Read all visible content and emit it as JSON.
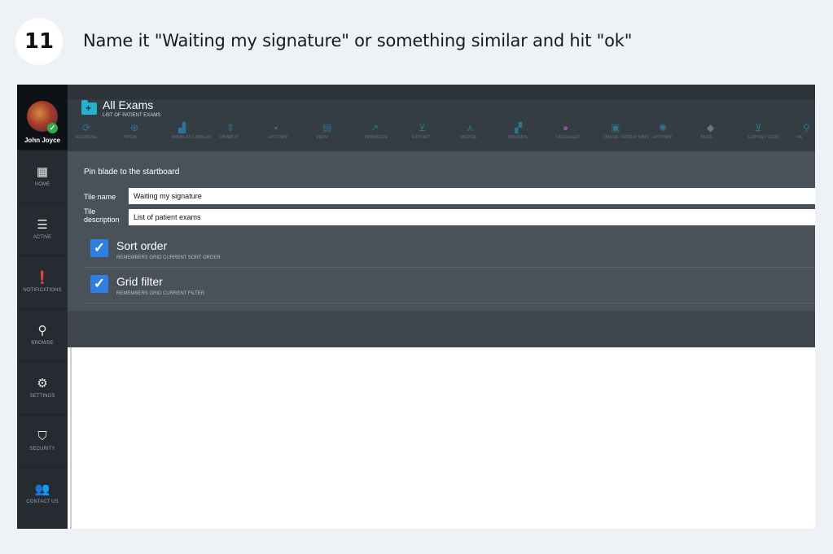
{
  "step": {
    "number": "11",
    "instruction": "Name it \"Waiting my signature\" or something similar and hit \"ok\""
  },
  "user": {
    "name": "John Joyce"
  },
  "sidebar": {
    "items": [
      {
        "label": "HOME",
        "icon": "home-grid-icon"
      },
      {
        "label": "ACTIVE",
        "icon": "list-icon"
      },
      {
        "label": "NOTIFICATIONS",
        "icon": "alert-icon"
      },
      {
        "label": "BROWSE",
        "icon": "search-icon"
      },
      {
        "label": "SETTINGS",
        "icon": "gear-icon"
      },
      {
        "label": "SECURITY",
        "icon": "shield-icon"
      },
      {
        "label": "CONTACT US",
        "icon": "people-icon"
      }
    ]
  },
  "header": {
    "title": "All Exams",
    "subtitle": "LIST OF PATIENT EXAMS",
    "toolbar": [
      {
        "label": "REFRESH",
        "icon": "refresh-icon"
      },
      {
        "label": "OPEN",
        "icon": "open-icon"
      },
      {
        "label": "MARK AS UNREAD",
        "icon": "mark-unread-icon"
      },
      {
        "label": "UNSPLIT",
        "icon": "unsplit-icon"
      },
      {
        "label": "HISTORY",
        "icon": "history-icon"
      },
      {
        "label": "VIEW",
        "icon": "view-icon"
      },
      {
        "label": "TRANSFER",
        "icon": "transfer-icon"
      },
      {
        "label": "EXPORT",
        "icon": "export-icon"
      },
      {
        "label": "MERGE",
        "icon": "merge-icon"
      },
      {
        "label": "ORDERS",
        "icon": "orders-icon"
      },
      {
        "label": "HIGHLIGHT",
        "icon": "highlight-icon"
      },
      {
        "label": "IMAGE OPERATIONS",
        "icon": "image-operations-icon"
      },
      {
        "label": "HISTORY",
        "icon": "history-icon"
      },
      {
        "label": "TAGS",
        "icon": "tags-icon"
      },
      {
        "label": "EXPORT GRID",
        "icon": "export-grid-icon"
      },
      {
        "label": "PA",
        "icon": "person-icon"
      }
    ]
  },
  "pin_blade": {
    "title": "Pin blade to the startboard",
    "tile_name_label": "Tile name",
    "tile_name_value": "Waiting my signature",
    "tile_description_label": "Tile description",
    "tile_description_value": "List of patient exams",
    "options": [
      {
        "title": "Sort order",
        "subtitle": "REMEMBERS GRID CURRENT SORT ORDER",
        "checked": true
      },
      {
        "title": "Grid filter",
        "subtitle": "REMEMBERS GRID CURRENT FILTER",
        "checked": true
      }
    ]
  }
}
